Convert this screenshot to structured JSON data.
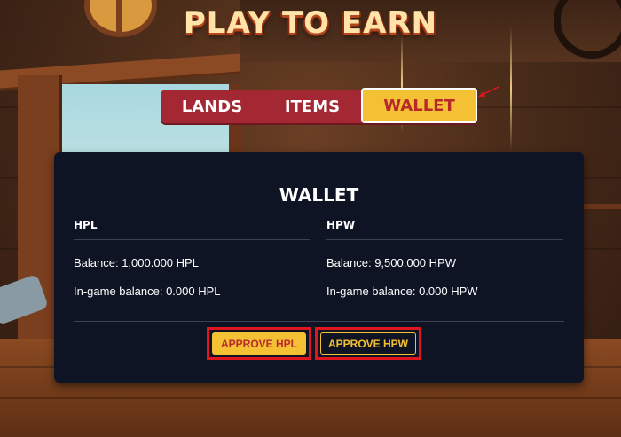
{
  "title": "PLAY TO EARN",
  "tabs": [
    {
      "label": "LANDS",
      "active": false
    },
    {
      "label": "ITEMS",
      "active": false
    },
    {
      "label": "WALLET",
      "active": true
    }
  ],
  "wallet": {
    "title": "WALLET",
    "hpl": {
      "heading": "HPL",
      "balance": "Balance: 1,000.000 HPL",
      "ingame_balance": "In-game balance: 0.000 HPL",
      "approve_label": "APPROVE HPL"
    },
    "hpw": {
      "heading": "HPW",
      "balance": "Balance: 9,500.000 HPW",
      "ingame_balance": "In-game balance: 0.000 HPW",
      "approve_label": "APPROVE HPW"
    }
  },
  "colors": {
    "accent_yellow": "#f4c034",
    "tab_bar_red": "#a42834",
    "panel_bg": "#0f1424",
    "highlight_red": "#e0151d"
  },
  "icons": [
    "arrow-pointer-icon"
  ]
}
